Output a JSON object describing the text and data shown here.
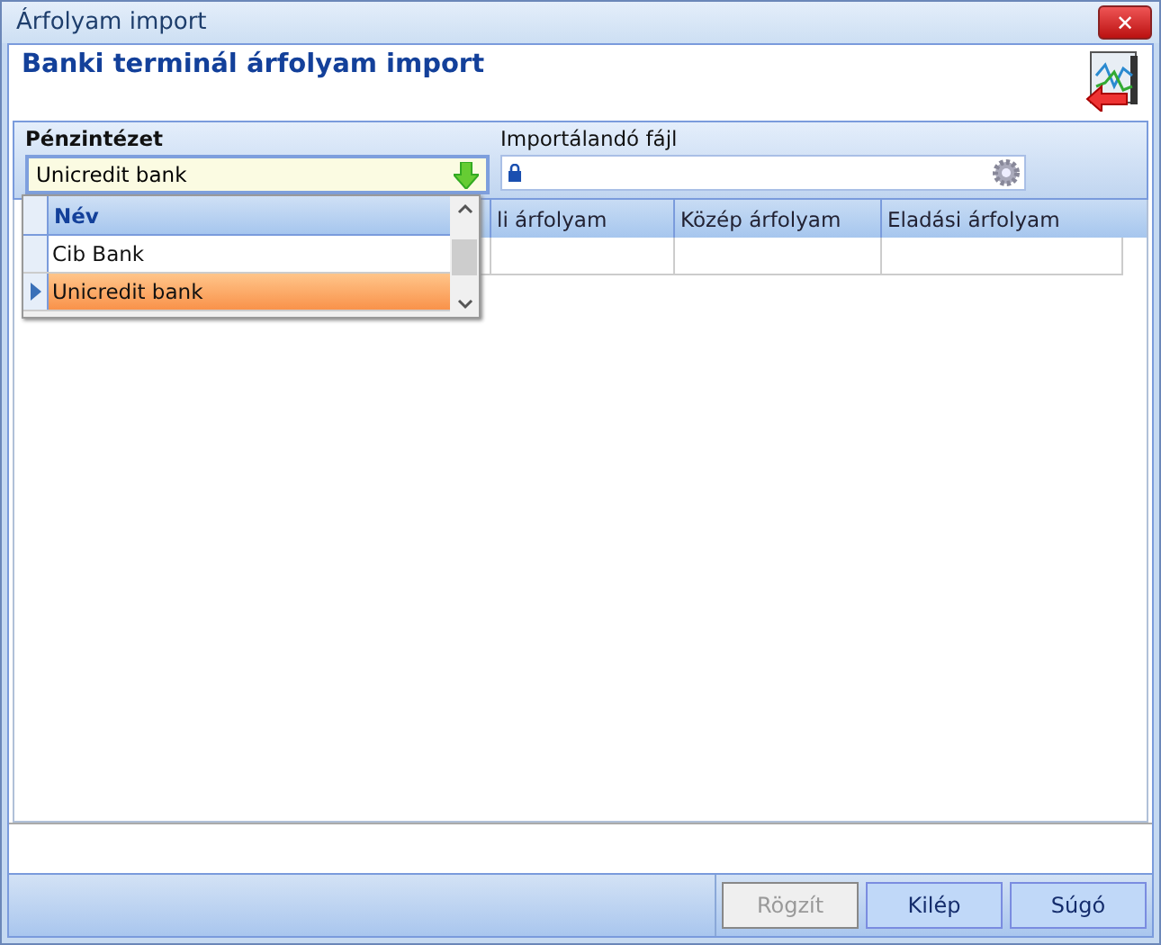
{
  "window": {
    "title": "Árfolyam import",
    "close": "✕"
  },
  "header": {
    "title": "Banki terminál árfolyam import"
  },
  "filters": [
    {
      "kind": "combo",
      "label": "Pénzintézet",
      "value": "Unicredit bank"
    },
    {
      "kind": "file",
      "label": "Importálandó fájl"
    }
  ],
  "dropdown": {
    "column": "Név",
    "rows": [
      {
        "name": "Cib Bank",
        "selected": false
      },
      {
        "name": "Unicredit bank",
        "selected": true
      }
    ]
  },
  "table": {
    "columns": [
      "",
      "li árfolyam",
      "Közép árfolyam",
      "Eladási árfolyam"
    ]
  },
  "buttons": [
    {
      "label": "Rögzít",
      "disabled": true
    },
    {
      "label": "Kilép",
      "disabled": false
    },
    {
      "label": "Súgó",
      "disabled": false
    }
  ]
}
